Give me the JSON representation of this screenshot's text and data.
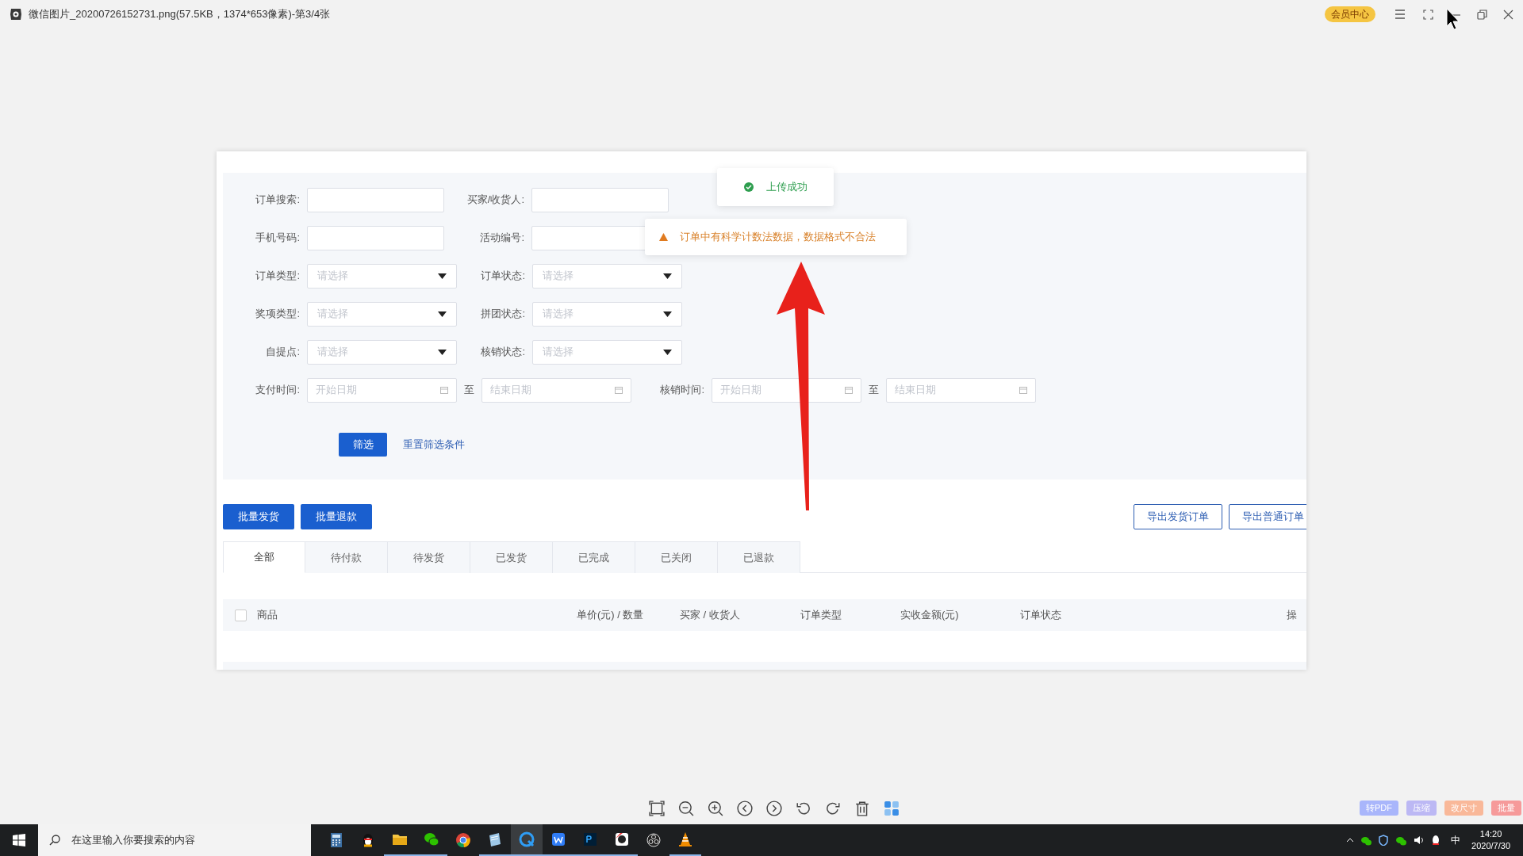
{
  "window": {
    "title": "微信图片_20200726152731.png(57.5KB，1374*653像素)-第3/4张",
    "vip_badge": "会员中心"
  },
  "image": {
    "filters": [
      {
        "fields": [
          {
            "label": "订单搜索:",
            "kind": "text"
          },
          {
            "label": "买家/收货人:",
            "kind": "text"
          }
        ]
      },
      {
        "fields": [
          {
            "label": "手机号码:",
            "kind": "text"
          },
          {
            "label": "活动编号:",
            "kind": "text"
          }
        ]
      },
      {
        "fields": [
          {
            "label": "订单类型:",
            "kind": "select",
            "placeholder": "请选择"
          },
          {
            "label": "订单状态:",
            "kind": "select",
            "placeholder": "请选择"
          }
        ]
      },
      {
        "fields": [
          {
            "label": "奖项类型:",
            "kind": "select",
            "placeholder": "请选择"
          },
          {
            "label": "拼团状态:",
            "kind": "select",
            "placeholder": "请选择"
          }
        ]
      },
      {
        "fields": [
          {
            "label": "自提点:",
            "kind": "select",
            "placeholder": "请选择"
          },
          {
            "label": "核销状态:",
            "kind": "select",
            "placeholder": "请选择"
          }
        ]
      },
      {
        "fields": [
          {
            "label": "支付时间:",
            "kind": "daterange",
            "start": "开始日期",
            "separator": "至",
            "end": "结束日期"
          },
          {
            "label": "核销时间:",
            "kind": "daterange",
            "start": "开始日期",
            "separator": "至",
            "end": "结束日期"
          }
        ]
      }
    ],
    "filter_button": "筛选",
    "reset_link": "重置筛选条件",
    "batch_buttons": [
      "批量发货",
      "批量退款"
    ],
    "export_buttons": [
      "导出发货订单",
      "导出普通订单"
    ],
    "tabs": [
      {
        "label": "全部",
        "selected": true
      },
      {
        "label": "待付款",
        "selected": false
      },
      {
        "label": "待发货",
        "selected": false
      },
      {
        "label": "已发货",
        "selected": false
      },
      {
        "label": "已完成",
        "selected": false
      },
      {
        "label": "已关闭",
        "selected": false
      },
      {
        "label": "已退款",
        "selected": false
      }
    ],
    "table": {
      "select_all_checked": false,
      "columns": [
        "商品",
        "单价(元) / 数量",
        "买家 / 收货人",
        "订单类型",
        "实收金额(元)",
        "订单状态",
        "操"
      ]
    },
    "toasts": [
      {
        "kind": "success",
        "text": "上传成功"
      },
      {
        "kind": "warning",
        "text": "订单中有科学计数法数据，数据格式不合法"
      }
    ]
  },
  "tool_badges": [
    {
      "label": "转PDF",
      "color": "#a9b6fb"
    },
    {
      "label": "压缩",
      "color": "#bcb8f4"
    },
    {
      "label": "改尺寸",
      "color": "#f9b899"
    },
    {
      "label": "批量",
      "color": "#f69a9a"
    }
  ],
  "taskbar": {
    "search_placeholder": "在这里输入你要搜索的内容",
    "ime": "中",
    "time": "14:20",
    "date": "2020/7/30"
  }
}
